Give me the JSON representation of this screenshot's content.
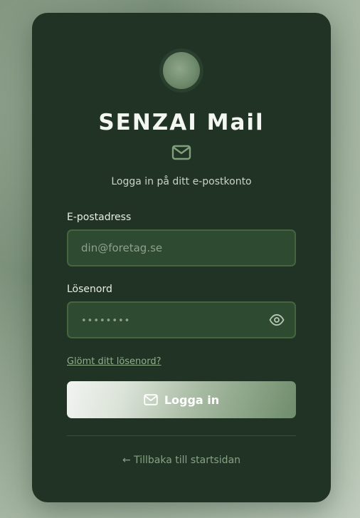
{
  "app": {
    "title": "SENZAI Mail",
    "subtitle": "Logga in på ditt e-postkonto"
  },
  "form": {
    "email_label": "E-postadress",
    "email_placeholder": "din@foretag.se",
    "password_label": "Lösenord",
    "password_masked": "••••••••",
    "forgot_link": "Glömt ditt lösenord?",
    "submit_label": "Logga in"
  },
  "footer": {
    "back_link": "← Tillbaka till startsidan"
  },
  "icons": {
    "brand": "mail-icon",
    "password_toggle": "eye-icon",
    "submit": "mail-icon"
  },
  "colors": {
    "card_background": "#203325",
    "accent": "#87a383"
  }
}
